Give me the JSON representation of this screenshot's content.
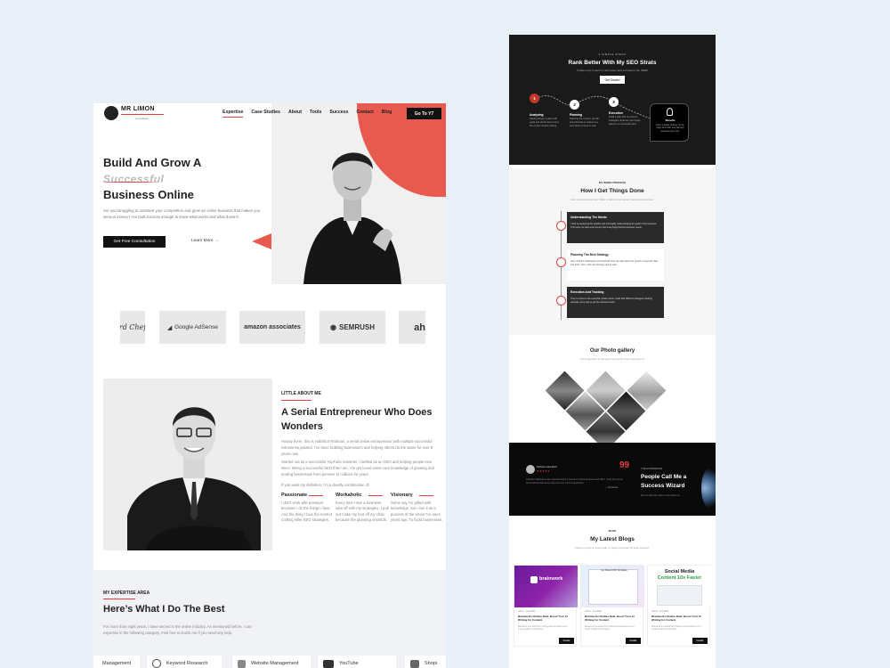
{
  "left": {
    "logo": {
      "name": "MR LIMON",
      "tagline": "Consultant"
    },
    "nav": {
      "items": [
        "Expertise",
        "Case Studies",
        "About",
        "Tools",
        "Success",
        "Contact",
        "Blog"
      ],
      "cta": "Go To Y7"
    },
    "hero": {
      "line1": "Build And Grow A",
      "line2": "Successful",
      "line3": "Business Online",
      "desc": "Are you struggling to outsmart your competition and grow an online business that makes you serious money? I've built success enough to know what works and what doesn't.",
      "primary": "Get Free Consultation",
      "secondary": "Learn More",
      "arrow": "→"
    },
    "logos": [
      "rd Chef",
      "Google AdSense",
      "amazon associates",
      "SEMRUSH",
      "ah"
    ],
    "about": {
      "kicker": "LITTLE ABOUT ME",
      "title": "A Serial Entrepreneur Who Does Wonders",
      "p1": "Howdy there, this is Hafizibur Rahman, a serial online entrepreneur with multiple successful milestones passed. I've been building businesses and helping others do the same for over 8 years now.",
      "p2": "Started out as a successful YouTube marketer, I settled as an SEO and helping people ever since. Being a successful SEO that I am, I've got loved some core knowledge of growing and scaling businesses from pennies to millions for years.",
      "p3": "If you want my definition, I'm a deadly combination of:",
      "traits": [
        {
          "title": "Passionate",
          "desc": "I don't work with pressure because I do the things I love. And the thing I love the most is crafting killer SEO strategies."
        },
        {
          "title": "Workaholic",
          "desc": "Every time I see a business take off with my strategies, I pull out I take my foot off my chair because the planning onwards."
        },
        {
          "title": "Visionary",
          "desc": "Some say I'm gifted with knowledge, but I see it as a process of the vision I've seen years ago. To build businesses."
        }
      ]
    },
    "expertise": {
      "kicker": "MY EXPERTISE AREA",
      "title": "Here’s What I Do The Best",
      "desc": "For more than eight years, I have served in the online industry. As mentioned before, I can expertise in the following category. Feel free to knock me if you need any help.",
      "cards": [
        "Management",
        "Keyword Research",
        "Website Management",
        "YouTube",
        "Shopi"
      ]
    }
  },
  "right": {
    "steps": {
      "kicker": "4 SIMPLE STEPS",
      "title": "Rank Better With My SEO Strats",
      "sub": "It takes only 4 steps to rank better and succeed in the SERP",
      "btn": "Get Started",
      "items": [
        {
          "num": "1",
          "title": "Analyzing",
          "desc": "Getting things in place with goals and all the data to find the current doubts ranking."
        },
        {
          "num": "2",
          "title": "Planning",
          "desc": "Planning the content, growth and schedule to reduce any such plans of time to rank."
        },
        {
          "num": "3",
          "title": "Execution",
          "desc": "Fulfill a plan with our proven strategies. Execute your things select to a successful rank."
        }
      ],
      "result": {
        "title": "Results",
        "desc": "Enjoy a stellar ranking, hit the sales and traffic and planning ahead to grow it all."
      }
    },
    "process": {
      "kicker": "MY WORK PROCESS",
      "title": "How I Get Things Done",
      "sub": "Here is the process that I follow to build & improve any successful business.",
      "items": [
        {
          "title": "Understanding The Needs",
          "desc": "I start by analyzing the website and thoroughly understanding the goals of the business. This helps me plan and connect with everything that the business needs."
        },
        {
          "title": "Planning The Best Strategy",
          "desc": "Next I find the bottlenecks and loopholes that can slow down the growth, using both data and tools. Then I plan the strategy step by step."
        },
        {
          "title": "Execution And Tracking",
          "desc": "Then it comes to the execution phase where I start with different strategies tracking carefully every step to get the desired results."
        }
      ]
    },
    "gallery": {
      "title": "Our Photo gallery",
      "sub": "Some glimpses of the work and events I have been part of"
    },
    "testimonial": {
      "name": "Mohammad Abid",
      "stars": "★★★★★",
      "quote": "99",
      "text": "Hafizibur Rahman is the real deal when it comes to online business and SEO. I took his course and implemented every step and now I rank everywhere.",
      "by": "— Mr Ahsan",
      "kicker": "THE EXPERIENCE",
      "title": "People Call Me a Success Wizard",
      "sub": "Here is what they have to say about me"
    },
    "blog": {
      "kicker": "BLOG",
      "title": "My Latest Blogs",
      "sub": "Follow my blog to know what I'm doing and what I've been learning.",
      "posts": [
        {
          "meta": "Admin · Sep 2023",
          "title": "Brainwork Lifetime Deal: Boost Your AI Writing for Content",
          "desc": "Brainwork is a powerful AI writing tool that helps you to create quality content faster.",
          "btn": "Details",
          "img_label": "brainwork"
        },
        {
          "meta": "Admin · Sep 2023",
          "title": "Brainwork Lifetime Deal: Boost Your AI Writing for Content",
          "desc": "Brainwork is a powerful AI writing tool that helps you to create quality content faster.",
          "btn": "Details",
          "img_label": "Get Started With Templates"
        },
        {
          "meta": "Admin · Sep 2023",
          "title": "Brainwork Lifetime Deal: Boost Your AI Writing for Content",
          "desc": "Brainwork is a powerful AI writing tool that helps you to create quality content faster.",
          "btn": "Details",
          "img_line1": "Social Media",
          "img_line2": "Content 10x Faster"
        }
      ]
    }
  }
}
